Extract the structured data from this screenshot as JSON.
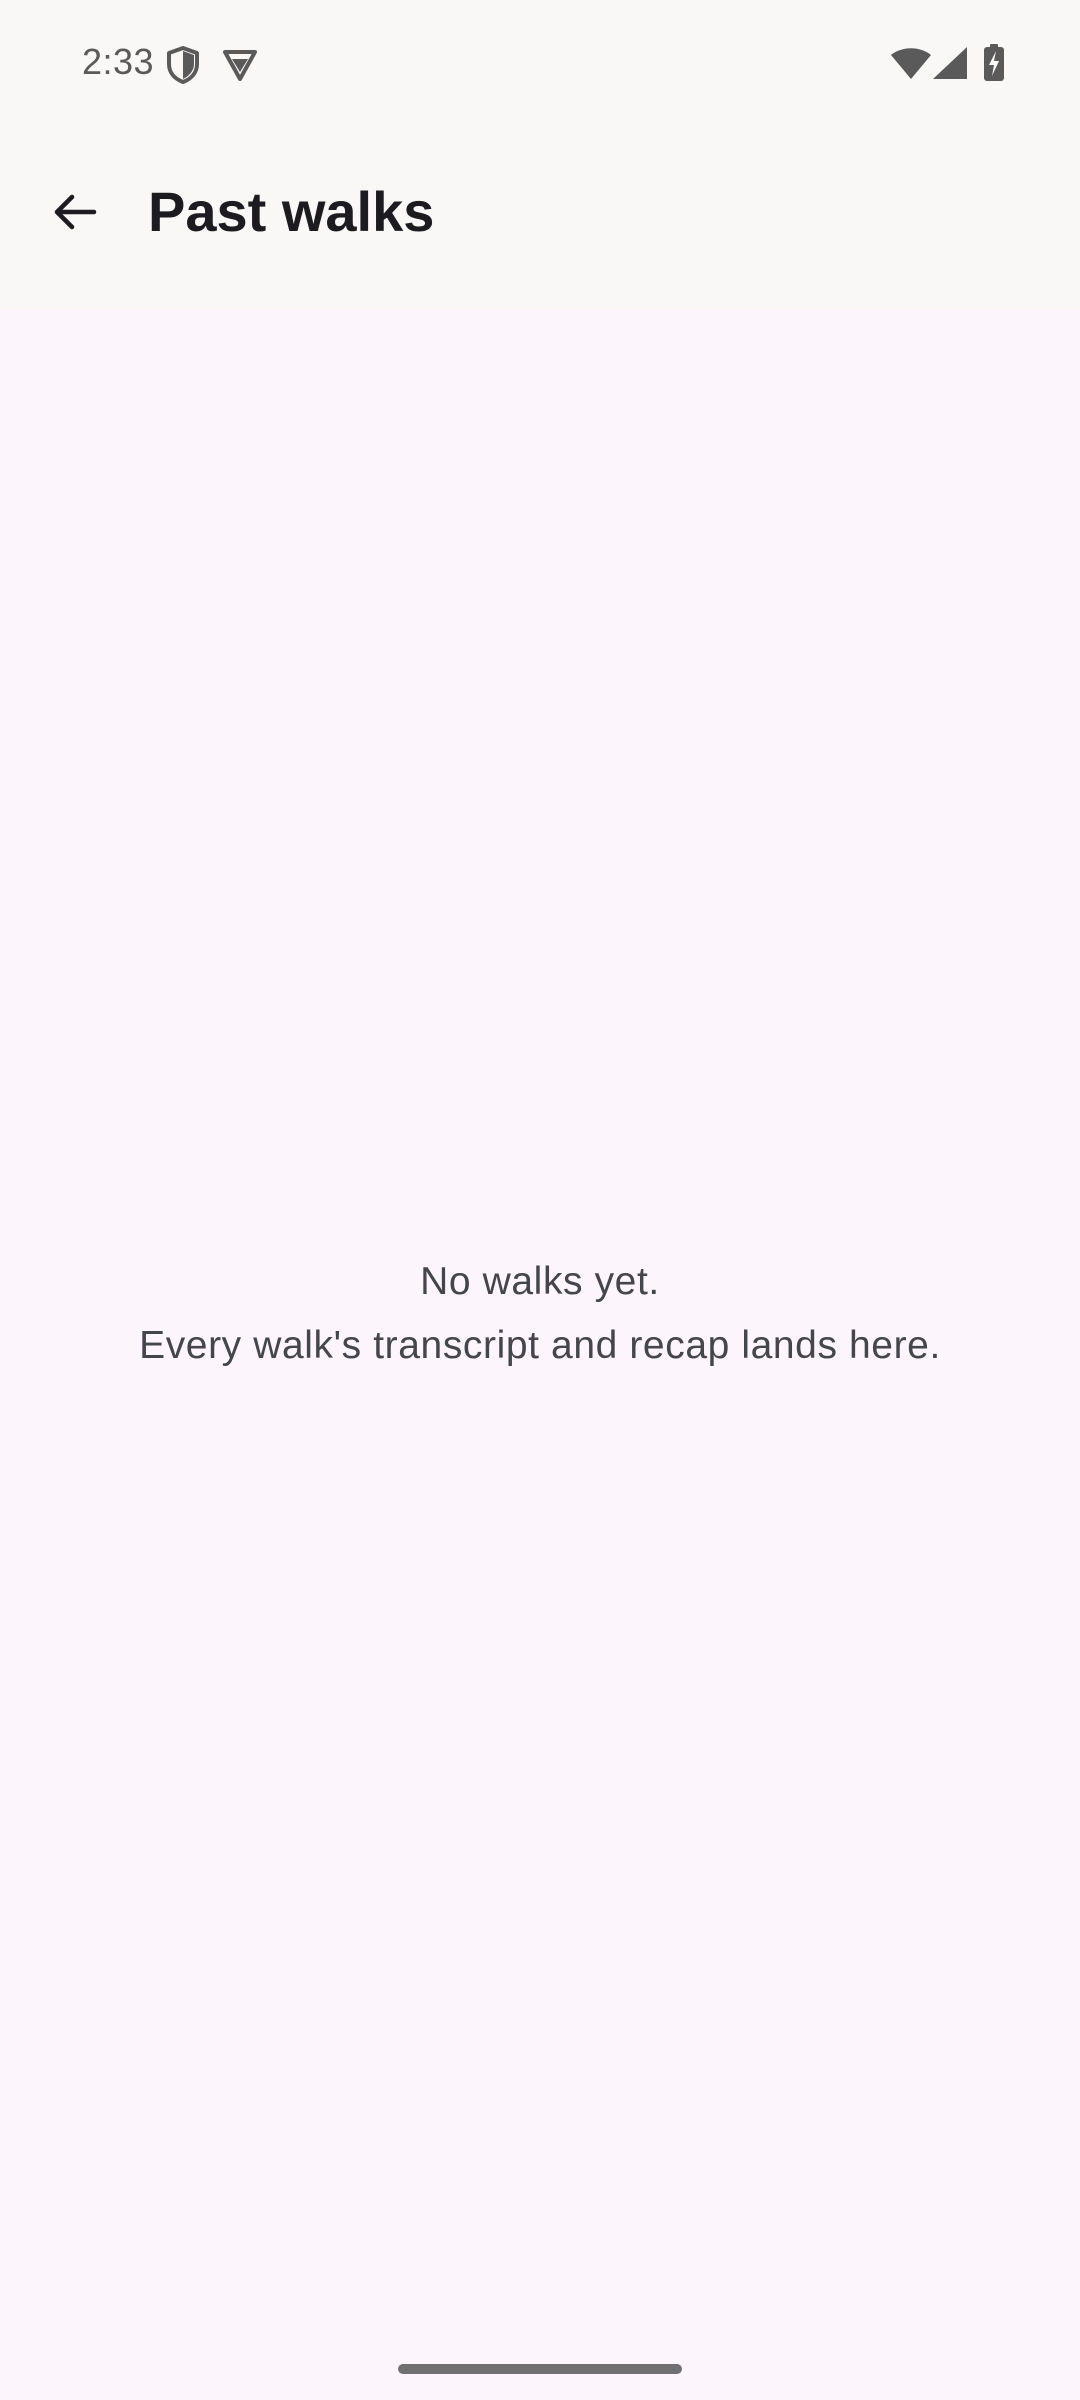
{
  "status_bar": {
    "time": "2:33",
    "left_icons": [
      "vpn-shield-icon",
      "app-notification-icon"
    ],
    "right_icons": [
      "wifi-icon",
      "cellular-signal-icon",
      "battery-charging-icon"
    ]
  },
  "app_bar": {
    "back_icon": "arrow-back-icon",
    "title": "Past walks"
  },
  "empty_state": {
    "heading": "No walks yet.",
    "message": "Every walk's transcript and recap lands here."
  },
  "colors": {
    "top_bar_background": "#faf8f6",
    "content_background": "#fcf6fc",
    "title_text": "#1c1b1f",
    "empty_text": "#45454c"
  }
}
